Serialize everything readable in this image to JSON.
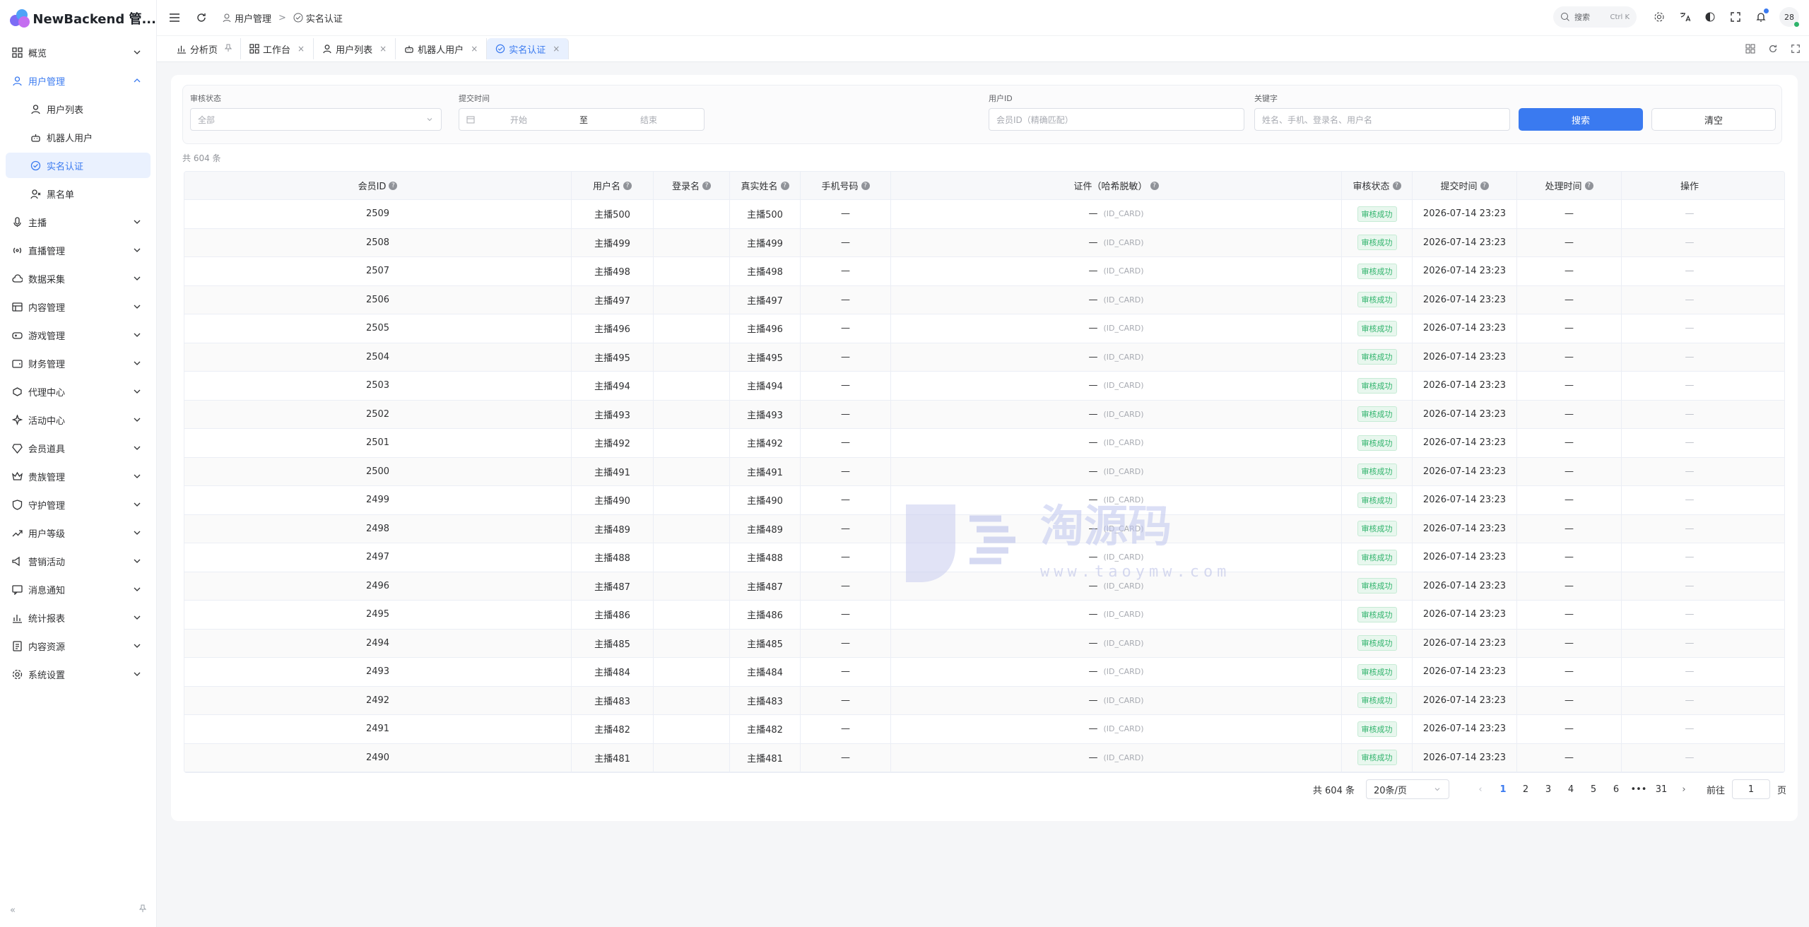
{
  "app": {
    "title": "NewBackend 管..."
  },
  "sidebar": {
    "items": [
      {
        "label": "概览",
        "icon": "grid-icon"
      },
      {
        "label": "用户管理",
        "icon": "user-icon"
      },
      {
        "label": "用户列表",
        "icon": "user-icon"
      },
      {
        "label": "机器人用户",
        "icon": "robot-icon"
      },
      {
        "label": "实名认证",
        "icon": "verify-icon"
      },
      {
        "label": "黑名单",
        "icon": "user-block-icon"
      },
      {
        "label": "主播",
        "icon": "mic-icon"
      },
      {
        "label": "直播管理",
        "icon": "broadcast-icon"
      },
      {
        "label": "数据采集",
        "icon": "cloud-icon"
      },
      {
        "label": "内容管理",
        "icon": "content-icon"
      },
      {
        "label": "游戏管理",
        "icon": "gamepad-icon"
      },
      {
        "label": "财务管理",
        "icon": "wallet-icon"
      },
      {
        "label": "代理中心",
        "icon": "agent-icon"
      },
      {
        "label": "活动中心",
        "icon": "sparkle-icon"
      },
      {
        "label": "会员道具",
        "icon": "gem-icon"
      },
      {
        "label": "贵族管理",
        "icon": "crown-icon"
      },
      {
        "label": "守护管理",
        "icon": "shield-icon"
      },
      {
        "label": "用户等级",
        "icon": "trend-icon"
      },
      {
        "label": "营销活动",
        "icon": "megaphone-icon"
      },
      {
        "label": "消息通知",
        "icon": "message-icon"
      },
      {
        "label": "统计报表",
        "icon": "chart-icon"
      },
      {
        "label": "内容资源",
        "icon": "resource-icon"
      },
      {
        "label": "系统设置",
        "icon": "gear-icon"
      }
    ]
  },
  "breadcrumb": {
    "parent": "用户管理",
    "current": "实名认证",
    "separator": ">"
  },
  "topbar": {
    "search_label": "搜索",
    "search_kbd": "Ctrl K",
    "avatar_text": "28"
  },
  "tabs": [
    {
      "label": "分析页",
      "icon": "chart-icon",
      "closer": "pin"
    },
    {
      "label": "工作台",
      "icon": "grid-icon",
      "closer": "×"
    },
    {
      "label": "用户列表",
      "icon": "user-icon",
      "closer": "×"
    },
    {
      "label": "机器人用户",
      "icon": "robot-icon",
      "closer": "×"
    },
    {
      "label": "实名认证",
      "icon": "verify-icon",
      "closer": "×"
    }
  ],
  "filters": {
    "status_label": "审核状态",
    "status_value": "全部",
    "time_label": "提交时间",
    "time_start": "开始",
    "time_to": "至",
    "time_end": "结束",
    "uid_label": "用户ID",
    "uid_placeholder": "会员ID（精确匹配）",
    "kw_label": "关键字",
    "kw_placeholder": "姓名、手机、登录名、用户名",
    "search_btn": "搜索",
    "clear_btn": "清空"
  },
  "table": {
    "total_text": "共 604 条",
    "columns": [
      "会员ID",
      "用户名",
      "登录名",
      "真实姓名",
      "手机号码",
      "证件（哈希脱敏）",
      "审核状态",
      "提交时间",
      "处理时间",
      "操作"
    ],
    "cert_type": "(ID_CARD)",
    "dash": "—",
    "op_dash": "—",
    "status_text": "审核成功",
    "submit_time": "2026-07-14 23:23",
    "rows": [
      {
        "id": "2509",
        "username": "主播500",
        "realname": "主播500"
      },
      {
        "id": "2508",
        "username": "主播499",
        "realname": "主播499"
      },
      {
        "id": "2507",
        "username": "主播498",
        "realname": "主播498"
      },
      {
        "id": "2506",
        "username": "主播497",
        "realname": "主播497"
      },
      {
        "id": "2505",
        "username": "主播496",
        "realname": "主播496"
      },
      {
        "id": "2504",
        "username": "主播495",
        "realname": "主播495"
      },
      {
        "id": "2503",
        "username": "主播494",
        "realname": "主播494"
      },
      {
        "id": "2502",
        "username": "主播493",
        "realname": "主播493"
      },
      {
        "id": "2501",
        "username": "主播492",
        "realname": "主播492"
      },
      {
        "id": "2500",
        "username": "主播491",
        "realname": "主播491"
      },
      {
        "id": "2499",
        "username": "主播490",
        "realname": "主播490"
      },
      {
        "id": "2498",
        "username": "主播489",
        "realname": "主播489"
      },
      {
        "id": "2497",
        "username": "主播488",
        "realname": "主播488"
      },
      {
        "id": "2496",
        "username": "主播487",
        "realname": "主播487"
      },
      {
        "id": "2495",
        "username": "主播486",
        "realname": "主播486"
      },
      {
        "id": "2494",
        "username": "主播485",
        "realname": "主播485"
      },
      {
        "id": "2493",
        "username": "主播484",
        "realname": "主播484"
      },
      {
        "id": "2492",
        "username": "主播483",
        "realname": "主播483"
      },
      {
        "id": "2491",
        "username": "主播482",
        "realname": "主播482"
      },
      {
        "id": "2490",
        "username": "主播481",
        "realname": "主播481"
      }
    ]
  },
  "pagination": {
    "total_text": "共 604 条",
    "page_size": "20条/页",
    "pages": [
      "1",
      "2",
      "3",
      "4",
      "5",
      "6",
      "•••",
      "31"
    ],
    "goto_label": "前往",
    "goto_value": "1",
    "page_unit": "页"
  },
  "watermark": {
    "text": "淘源码",
    "url": "www.taoymw.com"
  },
  "colors": {
    "accent": "#3a7af0",
    "success": "#2fb36b"
  }
}
